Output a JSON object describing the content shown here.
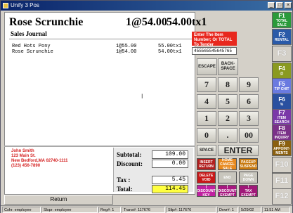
{
  "window": {
    "title": "Unify 3 Pos"
  },
  "item": {
    "name": "Rose Scrunchie",
    "qty_price": "1@54.00",
    "price": "54.00tx1"
  },
  "journal": {
    "title": "Sales Journal",
    "rows": [
      {
        "desc": "Red Hots Pony",
        "qty": "1@55.00",
        "amt": "55.00tx1"
      },
      {
        "desc": "Rose Scrunchie",
        "qty": "1@54.00",
        "amt": "54.00tx1"
      }
    ]
  },
  "customer": {
    "name": "John Smith",
    "addr1": "123 Main St.",
    "addr2": "New Bedford,MA 02740-1111",
    "phone": "(123) 456-7890"
  },
  "totals": {
    "subtotal_label": "Subtotal:",
    "subtotal": "109.00",
    "discount_label": "Discount:",
    "discount": "0.00",
    "tax_label": "Tax :",
    "tax": "5.45",
    "total_label": "Total:",
    "total": "114.45"
  },
  "return_label": "Return",
  "message": "Enter The Item Number; Or TOTAL To Tender",
  "input_value": "455565545645765",
  "keypad": {
    "escape": "ESCAPE",
    "backspace": "BACK-SPACE",
    "space": "SPACE",
    "enter": "ENTER",
    "nums": [
      "7",
      "8",
      "9",
      "4",
      "5",
      "6",
      "1",
      "2",
      "3",
      "0",
      ".",
      "00"
    ]
  },
  "color_keys": [
    {
      "label": "INSERT",
      "sub": "RETURN",
      "color": "#b22020"
    },
    {
      "label": "HOME",
      "sub": "CANCEL SALE",
      "color": "#e88a20"
    },
    {
      "label": "PAGEUP",
      "sub": "SUSPEND",
      "color": "#c87a10"
    },
    {
      "label": "DELETE",
      "sub": "VOID",
      "color": "#c81818"
    },
    {
      "label": "END",
      "sub": "",
      "color": "#c8c6bd"
    },
    {
      "label": "PAGE DOWN",
      "sub": "",
      "color": "#c8c6bd"
    },
    {
      "label": "|",
      "sub": "DISCOUNT KEY",
      "color": "#c020a0"
    },
    {
      "label": "|",
      "sub": "DISCOUNT EXEMPT",
      "color": "#a81880"
    },
    {
      "label": "\\",
      "sub": "TAX EXEMPT",
      "color": "#a01878"
    }
  ],
  "fkeys": [
    {
      "fn": "F1",
      "sub": "TOTAL SALE",
      "color": "#2a9a3a"
    },
    {
      "fn": "F2",
      "sub": "RENTAL",
      "color": "#2a5aa8"
    },
    {
      "fn": "F3",
      "sub": "",
      "color": "gray"
    },
    {
      "fn": "F4",
      "sub": "@",
      "color": "#8a9a20"
    },
    {
      "fn": "F5",
      "sub": "TIP CHIT",
      "color": "#6a7ae0"
    },
    {
      "fn": "F6",
      "sub": "%",
      "color": "#2a50a0"
    },
    {
      "fn": "F7",
      "sub": "ITEM SEARCH",
      "color": "#7a38a8"
    },
    {
      "fn": "F8",
      "sub": "ITEM INQUIRY",
      "color": "#7a3088"
    },
    {
      "fn": "F9",
      "sub": "APPOINT-MENTS",
      "color": "#8a6010"
    },
    {
      "fn": "F10",
      "sub": "",
      "color": "gray"
    },
    {
      "fn": "F11",
      "sub": "",
      "color": "gray"
    },
    {
      "fn": "F12",
      "sub": "",
      "color": "gray"
    }
  ],
  "status": [
    "Cshr: employee",
    "Slspr: employee",
    "Reg#: 1",
    "Trans#: 117676",
    "Slip#: 117676",
    "Drwr#: 1",
    "5/29/02",
    "11:51 AM"
  ]
}
